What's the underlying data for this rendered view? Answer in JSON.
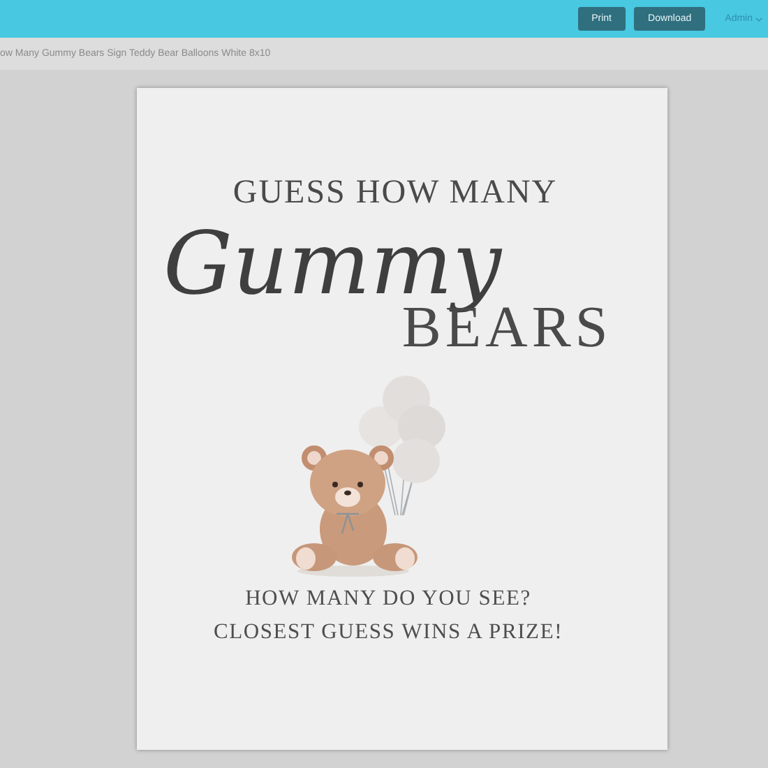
{
  "top_bar": {
    "buttons": [
      {
        "label": "Print"
      },
      {
        "label": "Download"
      }
    ],
    "user_menu": "Admin"
  },
  "breadcrumb": "ow Many Gummy Bears Sign Teddy Bear Balloons White 8x10",
  "sign": {
    "heading": "GUESS HOW MANY",
    "script_word": "Gummy",
    "title": "BEARS",
    "lines": [
      "HOW MANY DO YOU SEE?",
      "CLOSEST GUESS WINS A PRIZE!"
    ]
  }
}
